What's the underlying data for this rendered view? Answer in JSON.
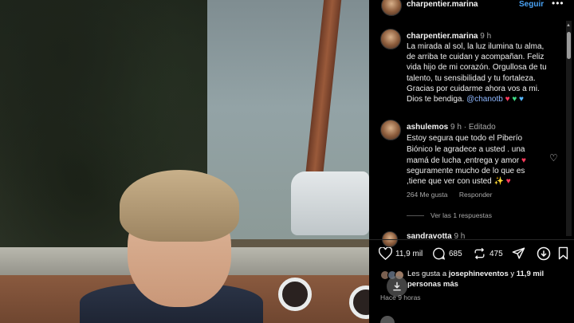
{
  "post": {
    "username": "charpentier.marina",
    "follow_label": "Seguir",
    "more_label": "•••"
  },
  "comments": [
    {
      "username": "charpentier.marina",
      "time": "9 h",
      "lines": [
        "La mirada al sol, la luz ilumina tu alma,",
        "de arriba te cuidan y acompañan.  Feliz",
        "vida hijo de mi corazón. Orgullosa de tu",
        "talento, tu sensibilidad y tu fortaleza.",
        "Gracias por cuidarme ahora vos a mi."
      ],
      "last_line": "Dios te bendiga.",
      "mention": "@chanotb"
    },
    {
      "username": "ashulemos",
      "time": "9 h · Editado",
      "lines": [
        "Estoy segura que todo el Piberío",
        "Biónico le agradece a usted . una",
        "mamá de lucha ,entrega y amor",
        "seguramente mucho de lo que es",
        ",tiene que ver con usted"
      ],
      "likes": "264 Me gusta",
      "reply_label": "Responder",
      "see_replies": "Ver las 1 respuestas"
    },
    {
      "username": "sandravotta",
      "time": "9 h"
    }
  ],
  "stats": {
    "likes": "11,9 mil",
    "comments": "685",
    "reposts": "475"
  },
  "liked_by": {
    "prefix": "Les gusta a",
    "user": "josephineventos",
    "connector": "y",
    "count": "11,9 mil",
    "suffix": "personas más"
  },
  "time_ago": "Hace 9 horas",
  "colors": {
    "accent_blue": "#4aa3f5",
    "mention": "#8fb8ff",
    "heart_red": "#ff3b5c"
  }
}
